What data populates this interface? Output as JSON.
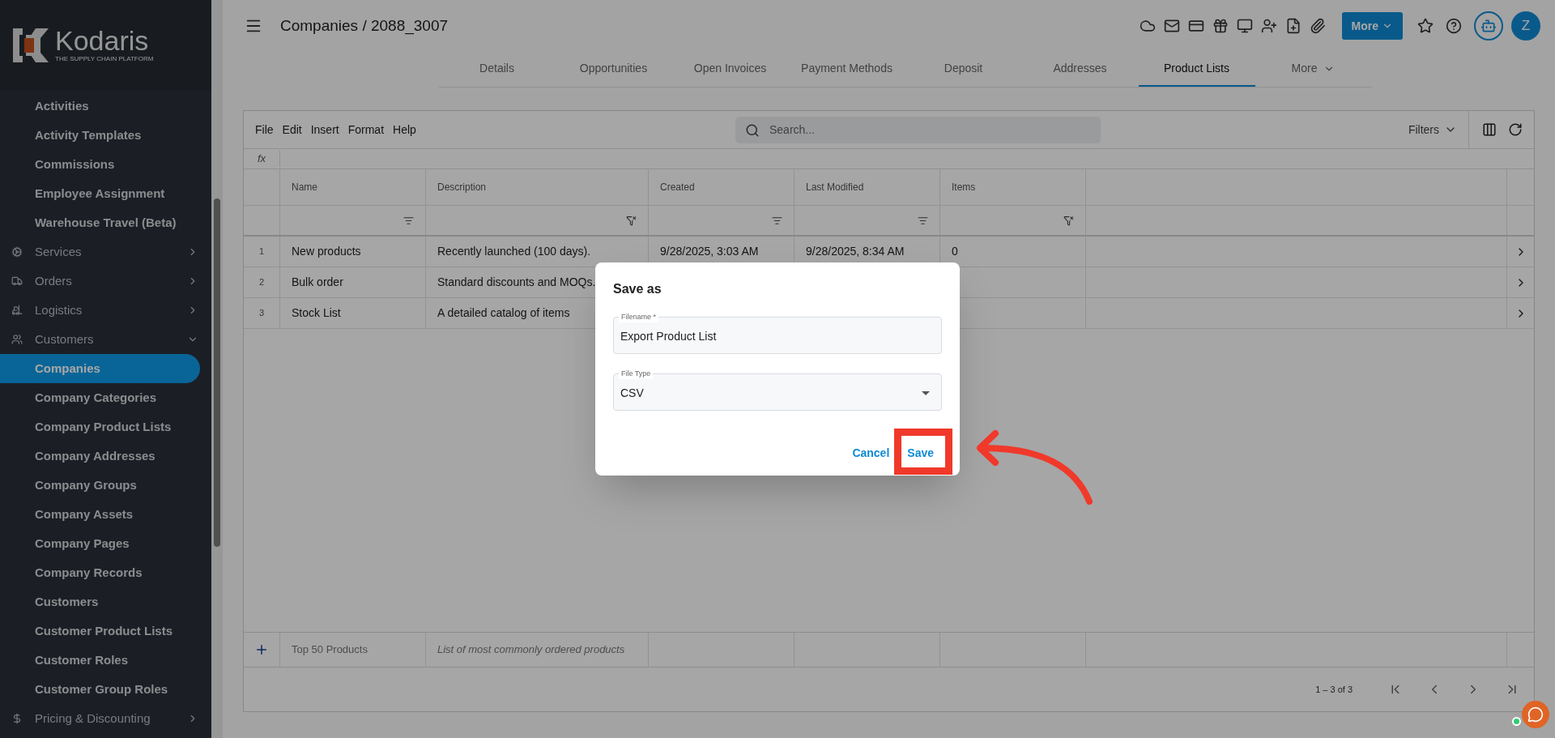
{
  "sidebar": {
    "logo": {
      "name": "Kodaris",
      "tagline": "THE SUPPLY CHAIN PLATFORM"
    },
    "items": [
      {
        "kind": "item",
        "label": "Activities",
        "selected": false
      },
      {
        "kind": "item",
        "label": "Activity Templates",
        "selected": false
      },
      {
        "kind": "item",
        "label": "Commissions",
        "selected": false
      },
      {
        "kind": "item",
        "label": "Employee Assignment",
        "selected": false
      },
      {
        "kind": "item",
        "label": "Warehouse Travel (Beta)",
        "selected": false
      },
      {
        "kind": "section",
        "label": "Services",
        "expanded": false
      },
      {
        "kind": "section",
        "label": "Orders",
        "expanded": false
      },
      {
        "kind": "section",
        "label": "Logistics",
        "expanded": false
      },
      {
        "kind": "section",
        "label": "Customers",
        "expanded": true
      },
      {
        "kind": "item",
        "label": "Companies",
        "selected": true
      },
      {
        "kind": "item",
        "label": "Company Categories",
        "selected": false
      },
      {
        "kind": "item",
        "label": "Company Product Lists",
        "selected": false
      },
      {
        "kind": "item",
        "label": "Company Addresses",
        "selected": false
      },
      {
        "kind": "item",
        "label": "Company Groups",
        "selected": false
      },
      {
        "kind": "item",
        "label": "Company Assets",
        "selected": false
      },
      {
        "kind": "item",
        "label": "Company Pages",
        "selected": false
      },
      {
        "kind": "item",
        "label": "Company Records",
        "selected": false
      },
      {
        "kind": "item",
        "label": "Customers",
        "selected": false
      },
      {
        "kind": "item",
        "label": "Customer Product Lists",
        "selected": false
      },
      {
        "kind": "item",
        "label": "Customer Roles",
        "selected": false
      },
      {
        "kind": "item",
        "label": "Customer Group Roles",
        "selected": false
      },
      {
        "kind": "section",
        "label": "Pricing & Discounting",
        "expanded": false
      }
    ]
  },
  "header": {
    "title": "Companies / 2088_3007",
    "more_button": "More",
    "avatar": "Z"
  },
  "tabs": [
    {
      "label": "Details",
      "selected": false
    },
    {
      "label": "Opportunities",
      "selected": false
    },
    {
      "label": "Open Invoices",
      "selected": false
    },
    {
      "label": "Payment Methods",
      "selected": false
    },
    {
      "label": "Deposit",
      "selected": false
    },
    {
      "label": "Addresses",
      "selected": false
    },
    {
      "label": "Product Lists",
      "selected": true
    },
    {
      "label": "More",
      "selected": false
    }
  ],
  "toolbar": {
    "menus": [
      "File",
      "Edit",
      "Insert",
      "Format",
      "Help"
    ],
    "search": {
      "placeholder": "Search..."
    },
    "filters": "Filters",
    "formula_label": "fx"
  },
  "table": {
    "columns": [
      {
        "label": "Name",
        "filter_off": false
      },
      {
        "label": "Description",
        "filter_off": true
      },
      {
        "label": "Created",
        "filter_off": false
      },
      {
        "label": "Last Modified",
        "filter_off": false
      },
      {
        "label": "Items",
        "filter_off": true
      }
    ],
    "rows": [
      {
        "number": "1",
        "cells": [
          "New products",
          "Recently launched (100 days).",
          "9/28/2025, 3:03 AM",
          "9/28/2025, 8:34 AM",
          "0"
        ]
      },
      {
        "number": "2",
        "cells": [
          "Bulk order",
          "Standard discounts and MOQs."
        ]
      },
      {
        "number": "3",
        "cells": [
          "Stock List",
          "A detailed catalog of items"
        ]
      }
    ],
    "new_row": {
      "name_placeholder": "Top 50 Products",
      "description_placeholder": "List of most commonly ordered products"
    },
    "pagination": "1 – 3 of 3"
  },
  "dialog": {
    "title": "Save as",
    "fields": [
      {
        "kind": "text",
        "label": "Filename *",
        "value": "Export Product List"
      },
      {
        "kind": "select",
        "label": "File Type",
        "value": "CSV"
      }
    ],
    "buttons": [
      {
        "label": "Cancel",
        "highlighted": false
      },
      {
        "label": "Save",
        "highlighted": true
      }
    ]
  }
}
